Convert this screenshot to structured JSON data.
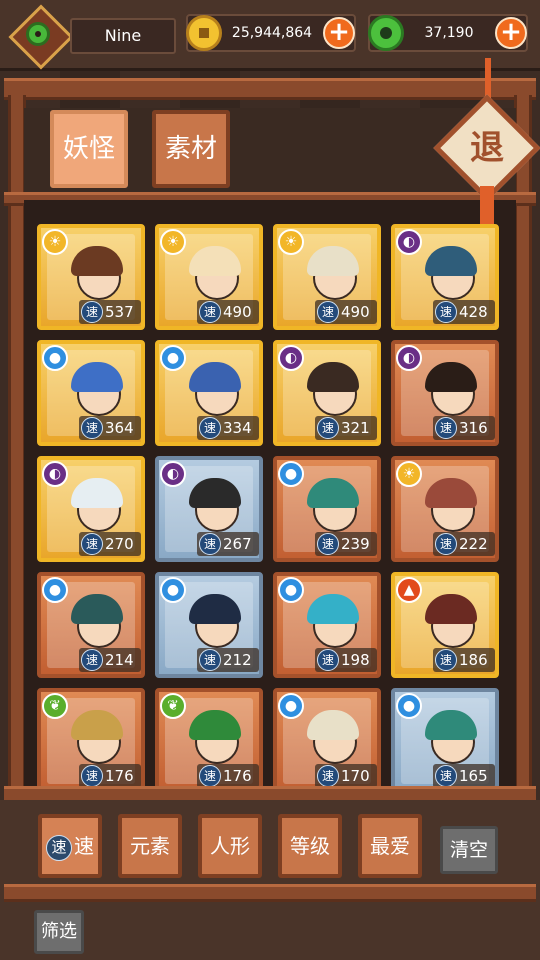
{
  "header": {
    "player_name": "Nine",
    "gold": "25,944,864",
    "jade": "37,190",
    "add_symbol": "+"
  },
  "tabs": [
    {
      "label": "妖怪",
      "active": true
    },
    {
      "label": "素材",
      "active": false
    }
  ],
  "exit_label": "退",
  "cards": [
    {
      "element": "light",
      "frame": "gold",
      "speed": "537",
      "hair": "#6b3a22"
    },
    {
      "element": "light",
      "frame": "gold",
      "speed": "490",
      "hair": "#f4e0b8"
    },
    {
      "element": "light",
      "frame": "gold",
      "speed": "490",
      "hair": "#e8e0c8"
    },
    {
      "element": "dark",
      "frame": "gold",
      "speed": "428",
      "hair": "#2f5d7a"
    },
    {
      "element": "water",
      "frame": "gold",
      "speed": "364",
      "hair": "#3e6fc6"
    },
    {
      "element": "water",
      "frame": "gold",
      "speed": "334",
      "hair": "#3a62b0"
    },
    {
      "element": "dark",
      "frame": "gold",
      "speed": "321",
      "hair": "#3a2a22"
    },
    {
      "element": "dark",
      "frame": "orange",
      "speed": "316",
      "hair": "#2a1d17"
    },
    {
      "element": "dark",
      "frame": "gold",
      "speed": "270",
      "hair": "#e6eef2"
    },
    {
      "element": "dark",
      "frame": "blue",
      "speed": "267",
      "hair": "#2a2a2a"
    },
    {
      "element": "water",
      "frame": "orange",
      "speed": "239",
      "hair": "#2f8a7a"
    },
    {
      "element": "light",
      "frame": "orange",
      "speed": "222",
      "hair": "#9a4a3a"
    },
    {
      "element": "water",
      "frame": "orange",
      "speed": "214",
      "hair": "#2a5a5a"
    },
    {
      "element": "water",
      "frame": "blue",
      "speed": "212",
      "hair": "#1f2c44"
    },
    {
      "element": "water",
      "frame": "orange",
      "speed": "198",
      "hair": "#34b0c8"
    },
    {
      "element": "fire",
      "frame": "gold",
      "speed": "186",
      "hair": "#6b2a22"
    },
    {
      "element": "wood",
      "frame": "orange",
      "speed": "176",
      "hair": "#c9a04a"
    },
    {
      "element": "wood",
      "frame": "orange",
      "speed": "176",
      "hair": "#2f8a3a"
    },
    {
      "element": "water",
      "frame": "orange",
      "speed": "170",
      "hair": "#e8e0c8"
    },
    {
      "element": "water",
      "frame": "blue",
      "speed": "165",
      "hair": "#2f8a7a"
    }
  ],
  "speed_icon_char": "速",
  "sort_buttons": [
    {
      "label": "速",
      "icon": "速",
      "active": true
    },
    {
      "label": "元素",
      "active": false
    },
    {
      "label": "人形",
      "active": false
    },
    {
      "label": "等级",
      "active": false
    },
    {
      "label": "最爱",
      "active": false
    }
  ],
  "clear_label": "清空",
  "filter_label": "筛选",
  "colors": {
    "gold_frame": "#f0b626",
    "orange_frame": "#a4512b",
    "blue_frame": "#6e86a0",
    "wood": "#8a4a2c",
    "accent_plus": "#f06a1d"
  }
}
